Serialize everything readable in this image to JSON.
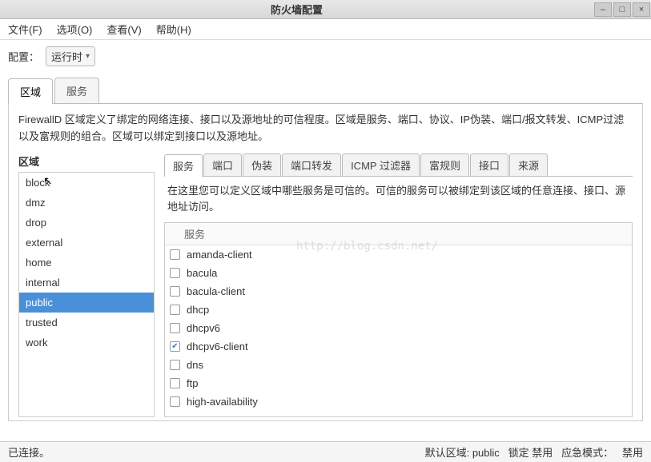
{
  "window": {
    "title": "防火墙配置"
  },
  "menu": {
    "file": "文件(F)",
    "options": "选项(O)",
    "view": "查看(V)",
    "help": "帮助(H)"
  },
  "config": {
    "label": "配置：",
    "value": "运行时"
  },
  "outerTabs": {
    "zone": "区域",
    "service": "服务"
  },
  "description": "FirewallD 区域定义了绑定的网络连接、接口以及源地址的可信程度。区域是服务、端口、协议、IP伪装、端口/报文转发、ICMP过滤以及富规则的组合。区域可以绑定到接口以及源地址。",
  "zoneHeader": "区域",
  "zones": [
    "block",
    "dmz",
    "drop",
    "external",
    "home",
    "internal",
    "public",
    "trusted",
    "work"
  ],
  "selectedZone": "public",
  "innerTabs": [
    "服务",
    "端口",
    "伪装",
    "端口转发",
    "ICMP 过滤器",
    "富规则",
    "接口",
    "来源"
  ],
  "serviceHelp": "在这里您可以定义区域中哪些服务是可信的。可信的服务可以被绑定到该区域的任意连接、接口、源地址访问。",
  "serviceColHeader": "服务",
  "services": [
    {
      "name": "amanda-client",
      "checked": false
    },
    {
      "name": "bacula",
      "checked": false
    },
    {
      "name": "bacula-client",
      "checked": false
    },
    {
      "name": "dhcp",
      "checked": false
    },
    {
      "name": "dhcpv6",
      "checked": false
    },
    {
      "name": "dhcpv6-client",
      "checked": true
    },
    {
      "name": "dns",
      "checked": false
    },
    {
      "name": "ftp",
      "checked": false
    },
    {
      "name": "high-availability",
      "checked": false
    }
  ],
  "status": {
    "connected": "已连接。",
    "defaultZoneLabel": "默认区域:",
    "defaultZone": "public",
    "lockLabel": "锁定",
    "lockValue": "禁用",
    "panicLabel": "应急模式：",
    "panicValue": "禁用"
  },
  "watermark": "http://blog.csdn.net/"
}
